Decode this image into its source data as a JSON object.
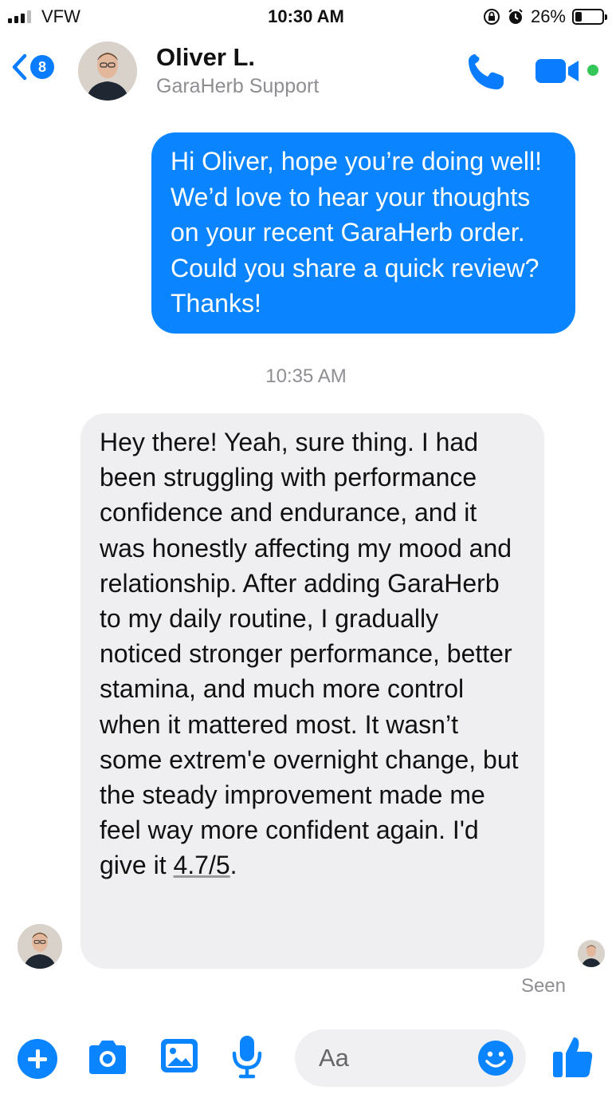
{
  "status_bar": {
    "carrier": "VFW",
    "time": "10:30 AM",
    "battery_text": "26%",
    "battery_level": 0.26
  },
  "header": {
    "unread_count": "8",
    "contact_name": "Oliver L.",
    "contact_subtitle": "GaraHerb Support",
    "online": true
  },
  "messages": {
    "sent": {
      "text": "Hi Oliver, hope you’re doing well! We’d love to hear your thoughts on your recent GaraHerb order. Could you share a quick review? Thanks!"
    },
    "timestamp": "10:35 AM",
    "received": {
      "text": "Hey there! Yeah, sure thing. I had been struggling with performance confidence and endurance, and it was honestly affecting my mood and relationship. After adding GaraHerb to my daily routine, I gradually noticed stronger performance, better stamina, and much more control when it mattered most. It wasn’t some extrem'e overnight change, but the steady improvement made me feel way more confident again. I'd give it ",
      "rating": "4.7/5",
      "suffix": "."
    },
    "seen_label": "Seen"
  },
  "composer": {
    "placeholder": "Aa"
  },
  "colors": {
    "accent": "#0a84ff",
    "sent_bubble": "#0a84ff",
    "received_bubble": "#efeff1",
    "online": "#35c659",
    "secondary_text": "#8e8e93"
  },
  "icons": {
    "back": "chevron-left-icon",
    "call": "phone-icon",
    "video": "video-camera-icon",
    "plus": "plus-icon",
    "camera": "camera-icon",
    "gallery": "image-icon",
    "mic": "microphone-icon",
    "emoji": "smiley-icon",
    "like": "thumbs-up-icon"
  }
}
